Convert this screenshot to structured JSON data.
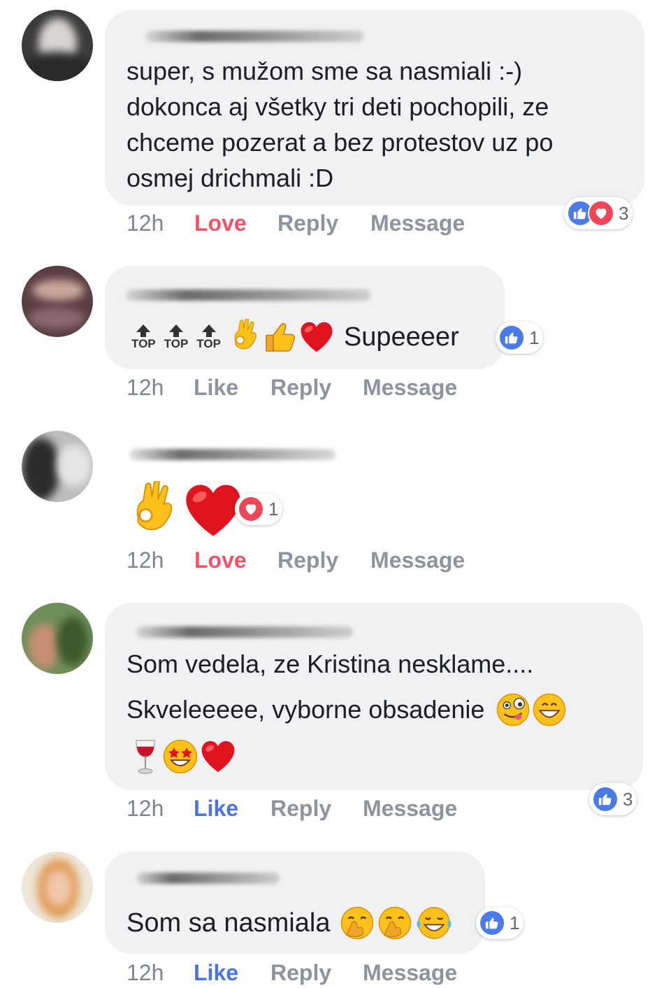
{
  "comments": [
    {
      "text_lines": [
        "super, s mužom sme sa nasmiali :-)",
        "dokonca aj všetky tri deti pochopili, ze",
        "chceme pozerat a bez protestov uz po",
        "osmej drichmali :D"
      ],
      "time": "12h",
      "primary_action": "Love",
      "reply": "Reply",
      "message": "Message",
      "reaction_icons": [
        "thumbs-up-icon",
        "heart-icon"
      ],
      "reaction_count": "3"
    },
    {
      "top_label": "TOP",
      "text": "Supeeeer",
      "emojis": [
        "ok-hand-emoji",
        "thumbs-up-emoji",
        "red-heart-emoji"
      ],
      "time": "12h",
      "primary_action": "Like",
      "reply": "Reply",
      "message": "Message",
      "reaction_icons": [
        "thumbs-up-icon"
      ],
      "reaction_count": "1"
    },
    {
      "emojis": [
        "ok-hand-emoji",
        "red-heart-emoji"
      ],
      "time": "12h",
      "primary_action": "Love",
      "reply": "Reply",
      "message": "Message",
      "reaction_icons": [
        "heart-icon"
      ],
      "reaction_count": "1"
    },
    {
      "text_lines": [
        "Som vedela, ze Kristina nesklame....",
        "Skveleeeee, vyborne obsadenie"
      ],
      "emojis_line2": [
        "zany-face-emoji",
        "grinning-face-emoji"
      ],
      "emojis_line3": [
        "wine-glass-emoji",
        "star-struck-emoji",
        "red-heart-emoji"
      ],
      "time": "12h",
      "primary_action": "Like",
      "reply": "Reply",
      "message": "Message",
      "reaction_icons": [
        "thumbs-up-icon"
      ],
      "reaction_count": "3"
    },
    {
      "text": "Som sa nasmiala",
      "emojis": [
        "face-with-hand-over-mouth-emoji",
        "face-with-hand-over-mouth-emoji",
        "tears-of-joy-emoji"
      ],
      "time": "12h",
      "primary_action": "Like",
      "reply": "Reply",
      "message": "Message",
      "reaction_icons": [
        "thumbs-up-icon"
      ],
      "reaction_count": "1"
    }
  ],
  "colors": {
    "love": "#f25268",
    "like": "#4a76d9",
    "muted": "#8d949e",
    "bubble": "#f0f1f3"
  }
}
